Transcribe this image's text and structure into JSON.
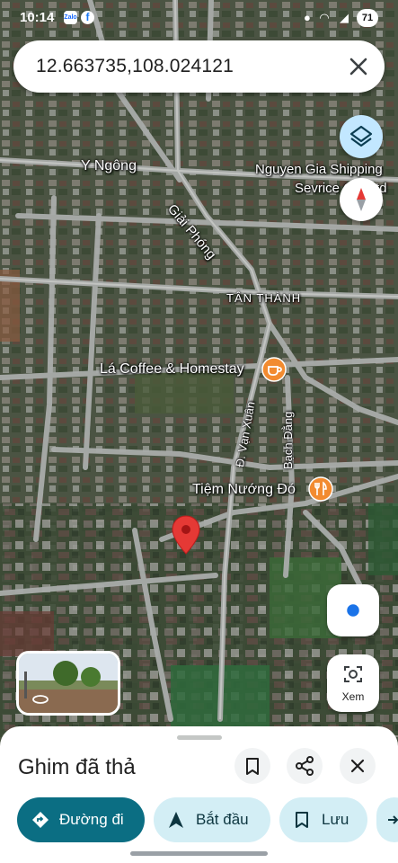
{
  "status_bar": {
    "time": "10:14",
    "battery": "71"
  },
  "search": {
    "query": "12.663735,108.024121"
  },
  "map": {
    "labels": {
      "y_ngong": "Y Ngông",
      "giai_phong": "Giải Phóng",
      "shipping_1": "Nguyen Gia Shipping",
      "shipping_2": "Sevrice Co.,Ltd",
      "tan_thanh": "TÂN THÀNH",
      "la_coffee": "Lá Coffee & Homestay",
      "van_xuan": "Đ. Vạn Xuân",
      "bach_dang": "Bạch Đằng",
      "tiem_nuong": "Tiệm Nướng Đó"
    }
  },
  "controls": {
    "xem_label": "Xem"
  },
  "sheet": {
    "title": "Ghim đã thả",
    "actions": {
      "directions": "Đường đi",
      "start": "Bắt đầu",
      "save": "Lưu"
    }
  },
  "colors": {
    "primary": "#0b6e83",
    "chip_bg": "#d3eef5",
    "pin": "#e53935",
    "poi": "#f28b30"
  }
}
